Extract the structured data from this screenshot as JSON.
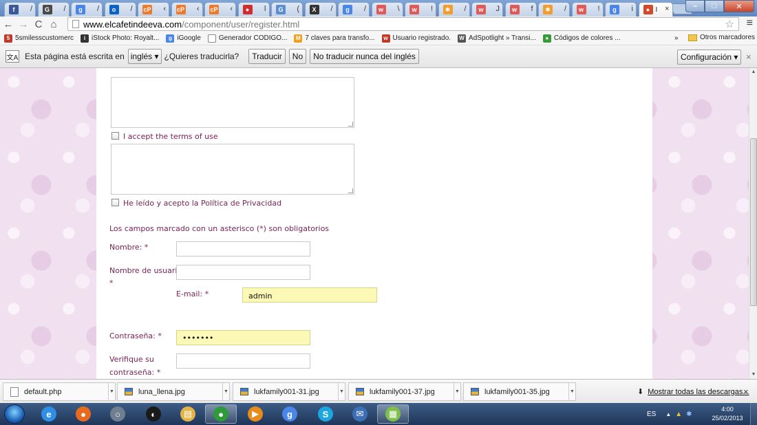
{
  "browser": {
    "tabs": [
      {
        "icon": "facebook-icon",
        "letter": "f",
        "color": "#3b5998",
        "close": "/"
      },
      {
        "icon": "g-icon",
        "letter": "G",
        "color": "#4a4a4a",
        "close": "/"
      },
      {
        "icon": "google-plus-icon",
        "letter": "g",
        "color": "#4a86e8",
        "close": "/"
      },
      {
        "icon": "outlook-icon",
        "letter": "o",
        "color": "#0a64c8",
        "close": "/"
      },
      {
        "icon": "cpanel-icon",
        "letter": "cP",
        "color": "#ee7a2b",
        "close": "‹"
      },
      {
        "icon": "cpanel-icon",
        "letter": "cP",
        "color": "#ee7a2b",
        "close": "‹"
      },
      {
        "icon": "cpanel-icon",
        "letter": "cP",
        "color": "#ee7a2b",
        "close": "‹"
      },
      {
        "icon": "red-circle-icon",
        "letter": "●",
        "color": "#d22d2d",
        "close": "l"
      },
      {
        "icon": "g-icon",
        "letter": "G",
        "color": "#5b8fd0",
        "close": "("
      },
      {
        "icon": "x-icon",
        "letter": "X",
        "color": "#333333",
        "close": "/"
      },
      {
        "icon": "google-plus-icon",
        "letter": "g",
        "color": "#4a86e8",
        "close": "/"
      },
      {
        "icon": "w-icon",
        "letter": "w",
        "color": "#e05a5a",
        "close": "\\"
      },
      {
        "icon": "w-icon",
        "letter": "w",
        "color": "#e05a5a",
        "close": "!"
      },
      {
        "icon": "joomla-icon",
        "letter": "✱",
        "color": "#f39b2c",
        "close": "/"
      },
      {
        "icon": "w-icon",
        "letter": "w",
        "color": "#e05a5a",
        "close": "J"
      },
      {
        "icon": "w-icon",
        "letter": "w",
        "color": "#e05a5a",
        "close": "f"
      },
      {
        "icon": "joomla-icon",
        "letter": "✱",
        "color": "#f39b2c",
        "close": "/"
      },
      {
        "icon": "w-icon",
        "letter": "w",
        "color": "#e05a5a",
        "close": "!"
      },
      {
        "icon": "google-plus-icon",
        "letter": "g",
        "color": "#4a86e8",
        "close": "i"
      },
      {
        "icon": "apple-icon",
        "letter": "●",
        "color": "#d24a2a",
        "close": "×",
        "title": "I",
        "active": true
      }
    ],
    "url_domain": "www.elcafetindeeva.com",
    "url_path": "/component/user/register.html",
    "bookmarks": [
      {
        "icon": "5smiles-icon",
        "letter": "5",
        "color": "#c0392b",
        "label": "5smilesscustomerc"
      },
      {
        "icon": "istock-icon",
        "letter": "i",
        "color": "#333333",
        "label": "iStock Photo: Royalt..."
      },
      {
        "icon": "google-plus-icon",
        "letter": "g",
        "color": "#4a86e8",
        "label": "iGoogle"
      },
      {
        "icon": "page-icon",
        "letter": "",
        "color": "#ffffff",
        "label": "Generador CODIGO..."
      },
      {
        "icon": "m-icon",
        "letter": "M",
        "color": "#f0a020",
        "label": "7 claves para transfo..."
      },
      {
        "icon": "w-icon",
        "letter": "w",
        "color": "#c0392b",
        "label": "Usuario registrado."
      },
      {
        "icon": "wordpress-icon",
        "letter": "W",
        "color": "#555555",
        "label": "AdSpotlight » Transi..."
      },
      {
        "icon": "color-wheel-icon",
        "letter": "●",
        "color": "#3a9a3a",
        "label": "Códigos de colores ..."
      }
    ],
    "bookmarks_more": "»",
    "other_bookmarks": "Otros marcadores"
  },
  "translate_bar": {
    "prefix": "Esta página está escrita en",
    "language": "inglés",
    "question": "¿Quieres traducirla?",
    "translate_button": "Traducir",
    "no_button": "No",
    "never_button": "No traducir nunca del inglés",
    "config_button": "Configuración",
    "close": "×"
  },
  "form": {
    "terms_label": "I accept the terms of use",
    "privacy_label": "He leído y acepto la Política de Privacidad",
    "required_note": "Los campos marcado con un asterisco (*) son obligatorios",
    "name_label": "Nombre: *",
    "name_value": "",
    "username_label": "Nombre de usuario:",
    "username_asterisk": "*",
    "username_value": "",
    "email_label": "E-mail: *",
    "email_value": "admin",
    "password_label": "Contraseña: *",
    "password_value": "•••••••",
    "verify_label_1": "Verifique su",
    "verify_label_2": "contraseña: *",
    "verify_value": ""
  },
  "downloads": {
    "items": [
      {
        "name": "default.php",
        "type": "file"
      },
      {
        "name": "luna_llena.jpg",
        "type": "image"
      },
      {
        "name": "lukfamily001-31.jpg",
        "type": "image"
      },
      {
        "name": "lukfamily001-37.jpg",
        "type": "image"
      },
      {
        "name": "lukfamily001-35.jpg",
        "type": "image"
      }
    ],
    "show_all": "Mostrar todas las descargas...",
    "close": "×"
  },
  "taskbar": {
    "apps": [
      {
        "icon": "internet-explorer-icon",
        "letter": "e",
        "color": "#2f8fe6"
      },
      {
        "icon": "firefox-icon",
        "letter": "●",
        "color": "#e66b1f"
      },
      {
        "icon": "circle-app-icon",
        "letter": "○",
        "color": "#6f7f8f"
      },
      {
        "icon": "media-icon",
        "letter": "◐",
        "color": "#1a1a1a"
      },
      {
        "icon": "explorer-icon",
        "letter": "▤",
        "color": "#e3b347"
      },
      {
        "icon": "chrome-icon",
        "letter": "●",
        "color": "#2e9a3a",
        "active": true
      },
      {
        "icon": "player-icon",
        "letter": "▶",
        "color": "#e78b1a"
      },
      {
        "icon": "google-plus-icon",
        "letter": "g",
        "color": "#4a86e8"
      },
      {
        "icon": "skype-icon",
        "letter": "S",
        "color": "#1ca6e0"
      },
      {
        "icon": "thunderbird-icon",
        "letter": "✉",
        "color": "#3c6fb4"
      },
      {
        "icon": "notepad-icon",
        "letter": "▦",
        "color": "#7fbf4c",
        "active": true
      }
    ],
    "language": "ES",
    "time": "4:00",
    "date": "25/02/2013"
  }
}
